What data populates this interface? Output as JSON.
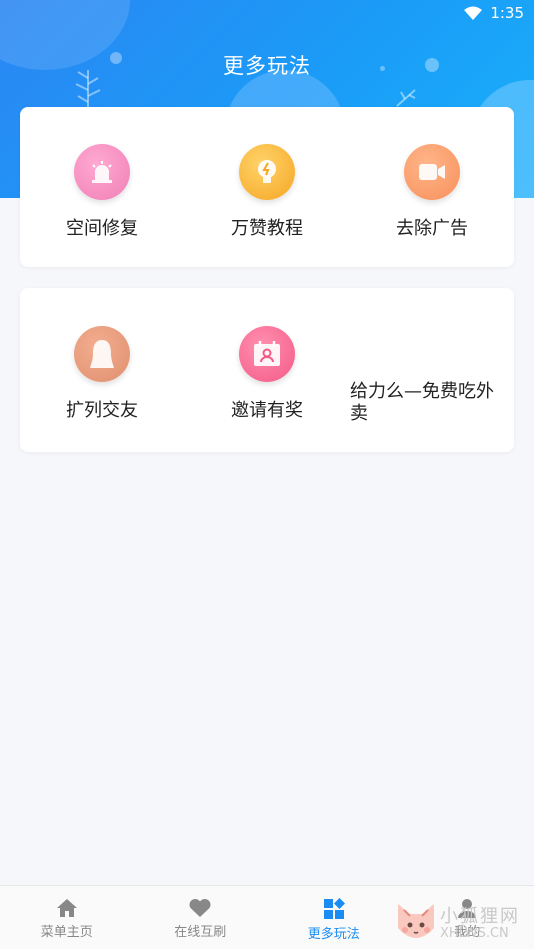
{
  "status_bar": {
    "time": "1:35"
  },
  "header": {
    "title": "更多玩法"
  },
  "grid1": [
    {
      "label": "空间修复",
      "icon": "alarm-icon",
      "color": "#f07fb6"
    },
    {
      "label": "万赞教程",
      "icon": "lightbulb-icon",
      "color": "#f5a623"
    },
    {
      "label": "去除广告",
      "icon": "video-icon",
      "color": "#f7905a"
    }
  ],
  "grid2": [
    {
      "label": "扩列交友",
      "icon": "person-silhouette-icon",
      "color": "#e0906f"
    },
    {
      "label": "邀请有奖",
      "icon": "calendar-user-icon",
      "color": "#f45a86"
    },
    {
      "label": "给力么—免费吃外卖"
    }
  ],
  "tabbar": [
    {
      "label": "菜单主页",
      "icon": "home-icon",
      "active": false
    },
    {
      "label": "在线互刷",
      "icon": "heart-icon",
      "active": false
    },
    {
      "label": "更多玩法",
      "icon": "grid-icon",
      "active": true
    },
    {
      "label": "我的",
      "icon": "user-icon",
      "active": false
    }
  ],
  "watermark": {
    "line1": "小狐狸网",
    "line2": "XHLWS.CN"
  },
  "colors": {
    "primary": "#1a8cf2",
    "header_start": "#2b86f3",
    "header_end": "#1ab0fb"
  }
}
